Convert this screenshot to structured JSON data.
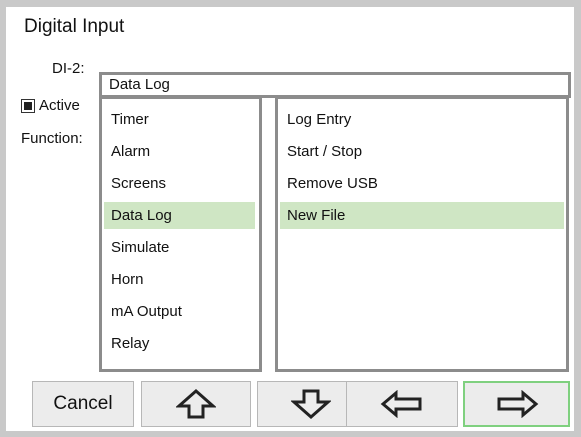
{
  "window": {
    "title": "Digital Input"
  },
  "settings": {
    "input_label": "DI-2:",
    "active_label": "Active",
    "function_label": "Function:"
  },
  "dialog": {
    "title": "Data Log",
    "left_items": [
      {
        "label": "Timer",
        "selected": false
      },
      {
        "label": "Alarm",
        "selected": false
      },
      {
        "label": "Screens",
        "selected": false
      },
      {
        "label": "Data Log",
        "selected": true
      },
      {
        "label": "Simulate",
        "selected": false
      },
      {
        "label": "Horn",
        "selected": false
      },
      {
        "label": "mA Output",
        "selected": false
      },
      {
        "label": "Relay",
        "selected": false
      }
    ],
    "right_items": [
      {
        "label": "Log Entry",
        "selected": false
      },
      {
        "label": "Start / Stop",
        "selected": false
      },
      {
        "label": "Remove USB",
        "selected": false
      },
      {
        "label": "New File",
        "selected": true
      }
    ]
  },
  "toolbar": {
    "cancel_label": "Cancel",
    "up_icon": "arrow-up-icon",
    "down_icon": "arrow-down-icon",
    "left_icon": "arrow-left-icon",
    "right_icon": "arrow-right-icon"
  },
  "colors": {
    "selection": "#cfe6c4",
    "border": "#8c8c8c",
    "focus": "#7fd07f"
  }
}
